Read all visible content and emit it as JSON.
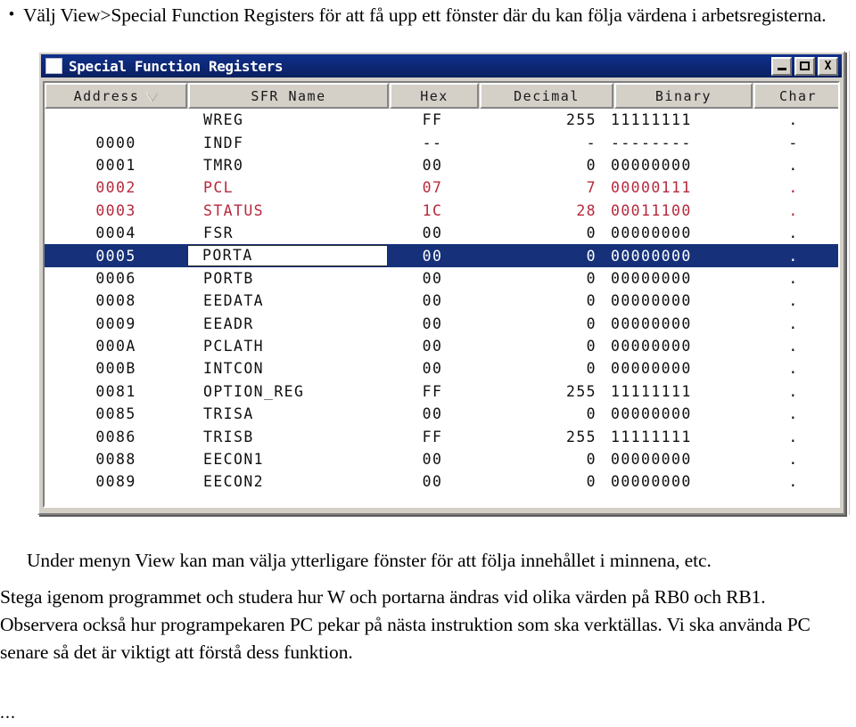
{
  "document": {
    "bullet_marker": "•",
    "bullet_paragraph": "Välj View>Special Function Registers för att få upp ett fönster där du kan följa värdena i arbetsregisterna.",
    "paragraph_under_menyn": "Under menyn View kan man välja ytterligare fönster för att följa innehållet i minnena, etc.",
    "paragraph_stega": "Stega igenom programmet och studera hur W och portarna ändras vid olika värden på RB0 och RB1. Observera också hur programpekaren PC pekar på nästa instruktion som ska verktällas. Vi ska använda PC senare så det är viktigt att förstå dess funktion.",
    "ellipsis": "..."
  },
  "window": {
    "title": "Special Function Registers",
    "icon": "window-document-icon",
    "buttons": {
      "minimize": "minimize-icon",
      "maximize": "maximize-icon",
      "close": "X"
    },
    "colors": {
      "titlebar": "#0a2472",
      "face": "#d4d0c8",
      "selection": "#16317a",
      "changed_value": "#b8283c"
    }
  },
  "table": {
    "columns": [
      {
        "label": "Address",
        "sort_indicator": "descending"
      },
      {
        "label": "SFR Name",
        "sort_indicator": ""
      },
      {
        "label": "Hex",
        "sort_indicator": ""
      },
      {
        "label": "Decimal",
        "sort_indicator": ""
      },
      {
        "label": "Binary",
        "sort_indicator": ""
      },
      {
        "label": "Char",
        "sort_indicator": ""
      }
    ],
    "rows": [
      {
        "address": "",
        "name": "WREG",
        "hex": "FF",
        "decimal": "255",
        "binary": "11111111",
        "char": ".",
        "changed": false,
        "selected": false
      },
      {
        "address": "0000",
        "name": "INDF",
        "hex": "--",
        "decimal": "-",
        "binary": "--------",
        "char": "-",
        "changed": false,
        "selected": false
      },
      {
        "address": "0001",
        "name": "TMR0",
        "hex": "00",
        "decimal": "0",
        "binary": "00000000",
        "char": ".",
        "changed": false,
        "selected": false
      },
      {
        "address": "0002",
        "name": "PCL",
        "hex": "07",
        "decimal": "7",
        "binary": "00000111",
        "char": ".",
        "changed": true,
        "selected": false
      },
      {
        "address": "0003",
        "name": "STATUS",
        "hex": "1C",
        "decimal": "28",
        "binary": "00011100",
        "char": ".",
        "changed": true,
        "selected": false
      },
      {
        "address": "0004",
        "name": "FSR",
        "hex": "00",
        "decimal": "0",
        "binary": "00000000",
        "char": ".",
        "changed": false,
        "selected": false
      },
      {
        "address": "0005",
        "name": "PORTA",
        "hex": "00",
        "decimal": "0",
        "binary": "00000000",
        "char": ".",
        "changed": false,
        "selected": true
      },
      {
        "address": "0006",
        "name": "PORTB",
        "hex": "00",
        "decimal": "0",
        "binary": "00000000",
        "char": ".",
        "changed": false,
        "selected": false
      },
      {
        "address": "0008",
        "name": "EEDATA",
        "hex": "00",
        "decimal": "0",
        "binary": "00000000",
        "char": ".",
        "changed": false,
        "selected": false
      },
      {
        "address": "0009",
        "name": "EEADR",
        "hex": "00",
        "decimal": "0",
        "binary": "00000000",
        "char": ".",
        "changed": false,
        "selected": false
      },
      {
        "address": "000A",
        "name": "PCLATH",
        "hex": "00",
        "decimal": "0",
        "binary": "00000000",
        "char": ".",
        "changed": false,
        "selected": false
      },
      {
        "address": "000B",
        "name": "INTCON",
        "hex": "00",
        "decimal": "0",
        "binary": "00000000",
        "char": ".",
        "changed": false,
        "selected": false
      },
      {
        "address": "0081",
        "name": "OPTION_REG",
        "hex": "FF",
        "decimal": "255",
        "binary": "11111111",
        "char": ".",
        "changed": false,
        "selected": false
      },
      {
        "address": "0085",
        "name": "TRISA",
        "hex": "00",
        "decimal": "0",
        "binary": "00000000",
        "char": ".",
        "changed": false,
        "selected": false
      },
      {
        "address": "0086",
        "name": "TRISB",
        "hex": "FF",
        "decimal": "255",
        "binary": "11111111",
        "char": ".",
        "changed": false,
        "selected": false
      },
      {
        "address": "0088",
        "name": "EECON1",
        "hex": "00",
        "decimal": "0",
        "binary": "00000000",
        "char": ".",
        "changed": false,
        "selected": false
      },
      {
        "address": "0089",
        "name": "EECON2",
        "hex": "00",
        "decimal": "0",
        "binary": "00000000",
        "char": ".",
        "changed": false,
        "selected": false
      }
    ]
  }
}
